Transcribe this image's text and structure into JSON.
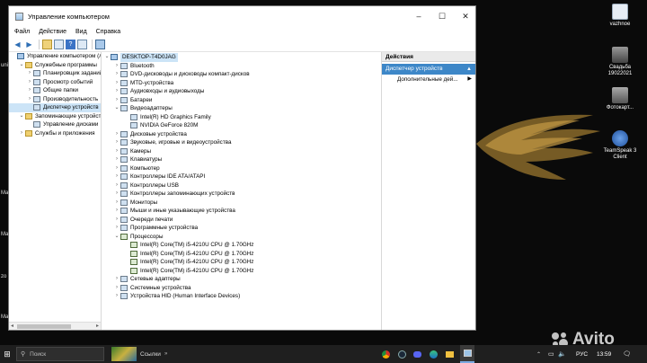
{
  "window": {
    "title": "Управление компьютером",
    "menu": [
      "Файл",
      "Действие",
      "Вид",
      "Справка"
    ]
  },
  "left_tree": [
    {
      "label": "Управление компьютером (л",
      "exp": "",
      "indent": 0,
      "selected": false
    },
    {
      "label": "Служебные программы",
      "exp": "⌄",
      "indent": 1,
      "selected": false
    },
    {
      "label": "Планировщик заданий",
      "exp": "›",
      "indent": 2,
      "selected": false
    },
    {
      "label": "Просмотр событий",
      "exp": "›",
      "indent": 2,
      "selected": false
    },
    {
      "label": "Общие папки",
      "exp": "›",
      "indent": 2,
      "selected": false
    },
    {
      "label": "Производительность",
      "exp": "›",
      "indent": 2,
      "selected": false
    },
    {
      "label": "Диспетчер устройств",
      "exp": "",
      "indent": 2,
      "selected": true
    },
    {
      "label": "Запоминающие устройств",
      "exp": "⌄",
      "indent": 1,
      "selected": false
    },
    {
      "label": "Управление дисками",
      "exp": "",
      "indent": 2,
      "selected": false
    },
    {
      "label": "Службы и приложения",
      "exp": "›",
      "indent": 1,
      "selected": false
    }
  ],
  "device_tree": [
    {
      "label": "DESKTOP-T4D0JAG",
      "exp": "⌄",
      "indent": 0,
      "kind": "comp",
      "root": true
    },
    {
      "label": "Bluetooth",
      "exp": "›",
      "indent": 1,
      "kind": "dev"
    },
    {
      "label": "DVD-дисководы и дисководы компакт-дисков",
      "exp": "›",
      "indent": 1,
      "kind": "dev"
    },
    {
      "label": "MTD-устройства",
      "exp": "›",
      "indent": 1,
      "kind": "dev"
    },
    {
      "label": "Аудиовходы и аудиовыходы",
      "exp": "›",
      "indent": 1,
      "kind": "dev"
    },
    {
      "label": "Батареи",
      "exp": "›",
      "indent": 1,
      "kind": "dev"
    },
    {
      "label": "Видеоадаптеры",
      "exp": "⌄",
      "indent": 1,
      "kind": "dev"
    },
    {
      "label": "Intel(R) HD Graphics Family",
      "exp": "",
      "indent": 2,
      "kind": "dev"
    },
    {
      "label": "NVIDIA GeForce 820M",
      "exp": "",
      "indent": 2,
      "kind": "dev"
    },
    {
      "label": "Дисковые устройства",
      "exp": "›",
      "indent": 1,
      "kind": "dev"
    },
    {
      "label": "Звуковые, игровые и видеоустройства",
      "exp": "›",
      "indent": 1,
      "kind": "dev"
    },
    {
      "label": "Камеры",
      "exp": "›",
      "indent": 1,
      "kind": "dev"
    },
    {
      "label": "Клавиатуры",
      "exp": "›",
      "indent": 1,
      "kind": "dev"
    },
    {
      "label": "Компьютер",
      "exp": "›",
      "indent": 1,
      "kind": "dev"
    },
    {
      "label": "Контроллеры IDE ATA/ATAPI",
      "exp": "›",
      "indent": 1,
      "kind": "dev"
    },
    {
      "label": "Контроллеры USB",
      "exp": "›",
      "indent": 1,
      "kind": "dev"
    },
    {
      "label": "Контроллеры запоминающих устройств",
      "exp": "›",
      "indent": 1,
      "kind": "dev"
    },
    {
      "label": "Мониторы",
      "exp": "›",
      "indent": 1,
      "kind": "dev"
    },
    {
      "label": "Мыши и иные указывающие устройства",
      "exp": "›",
      "indent": 1,
      "kind": "dev"
    },
    {
      "label": "Очереди печати",
      "exp": "›",
      "indent": 1,
      "kind": "dev"
    },
    {
      "label": "Программные устройства",
      "exp": "›",
      "indent": 1,
      "kind": "dev"
    },
    {
      "label": "Процессоры",
      "exp": "⌄",
      "indent": 1,
      "kind": "chip"
    },
    {
      "label": "Intel(R) Core(TM) i5-4210U CPU @ 1.70GHz",
      "exp": "",
      "indent": 2,
      "kind": "chip"
    },
    {
      "label": "Intel(R) Core(TM) i5-4210U CPU @ 1.70GHz",
      "exp": "",
      "indent": 2,
      "kind": "chip"
    },
    {
      "label": "Intel(R) Core(TM) i5-4210U CPU @ 1.70GHz",
      "exp": "",
      "indent": 2,
      "kind": "chip"
    },
    {
      "label": "Intel(R) Core(TM) i5-4210U CPU @ 1.70GHz",
      "exp": "",
      "indent": 2,
      "kind": "chip"
    },
    {
      "label": "Сетевые адаптеры",
      "exp": "›",
      "indent": 1,
      "kind": "dev"
    },
    {
      "label": "Системные устройства",
      "exp": "›",
      "indent": 1,
      "kind": "dev"
    },
    {
      "label": "Устройства HID (Human Interface Devices)",
      "exp": "›",
      "indent": 1,
      "kind": "dev"
    }
  ],
  "actions": {
    "header": "Действия",
    "section": "Диспетчер устройств",
    "item": "Дополнительные дей..."
  },
  "desktop_icons": [
    {
      "label": "vazhnoe",
      "color": "#dfe8f2"
    },
    {
      "label": "Свадьба 19022021",
      "color": "#555555"
    },
    {
      "label": "Фотокарт...",
      "color": "#777777"
    },
    {
      "label": "TeamSpeak 3 Client",
      "color": "#2a5fb0"
    }
  ],
  "edge_texts": [
    "uni",
    "Ma",
    "Ma",
    "zo",
    "Ma"
  ],
  "taskbar": {
    "search_placeholder": "Поиск",
    "tray_label": "Ссылки",
    "lang": "РУС",
    "time": "13:59"
  },
  "watermark": "Avito",
  "colors": {
    "selection": "#cce4f7",
    "accent": "#3d87c8",
    "taskbar": "#1f1f1f"
  }
}
